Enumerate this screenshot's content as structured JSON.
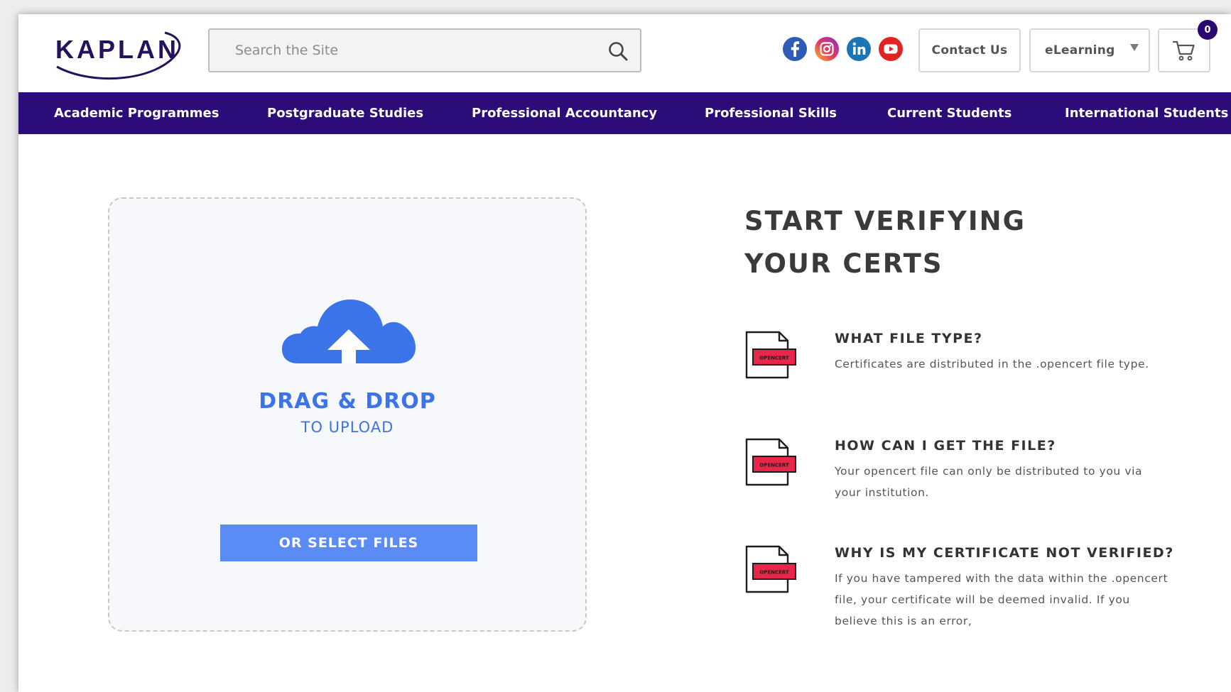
{
  "header": {
    "logo_text": "KAPLAN",
    "search": {
      "placeholder": "Search the Site",
      "value": ""
    },
    "social": [
      "facebook-icon",
      "instagram-icon",
      "linkedin-icon",
      "youtube-icon"
    ],
    "contact_label": "Contact Us",
    "elearning_label": "eLearning",
    "cart_count": "0"
  },
  "nav": {
    "items": [
      "Academic Programmes",
      "Postgraduate Studies",
      "Professional Accountancy",
      "Professional Skills",
      "Current Students",
      "International Students"
    ]
  },
  "upload": {
    "title": "DRAG & DROP",
    "subtitle": "TO UPLOAD",
    "button_label": "OR SELECT FILES"
  },
  "info": {
    "title_line1": "START VERIFYING",
    "title_line2": "YOUR CERTS",
    "icon_label": "OPENCERT",
    "blocks": [
      {
        "heading": "WHAT FILE TYPE?",
        "text": "Certificates are distributed in the .opencert file type."
      },
      {
        "heading": "HOW CAN I GET THE FILE?",
        "text": "Your opencert file can only be distributed to you via your institution."
      },
      {
        "heading": "WHY IS MY CERTIFICATE NOT VERIFIED?",
        "text": "If you have tampered with the data within the .opencert file, your certificate will be deemed invalid. If you believe this is an error,"
      }
    ]
  },
  "colors": {
    "nav_bg": "#2b0c78",
    "accent_blue": "#3b74e8",
    "button_blue": "#5b8cf5",
    "opencert_red": "#e8264a"
  }
}
